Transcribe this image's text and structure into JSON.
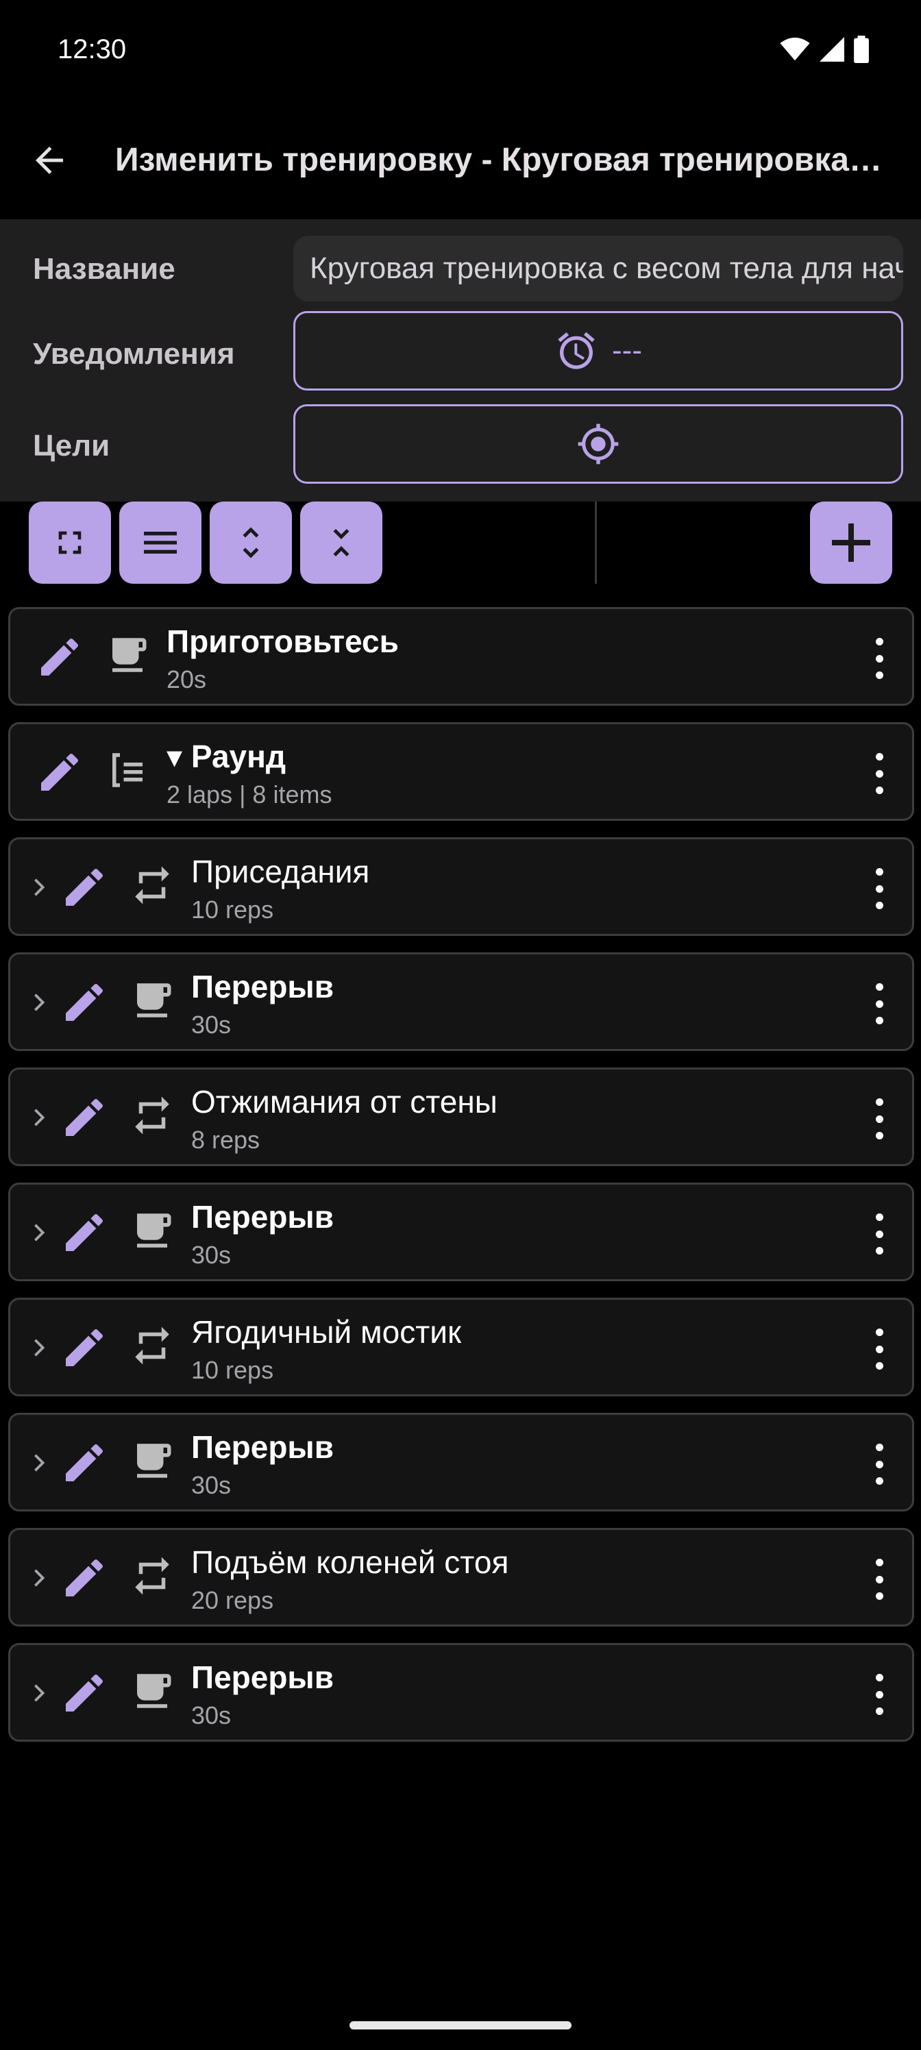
{
  "status_bar": {
    "time": "12:30"
  },
  "app_bar": {
    "title": "Изменить тренировку - Круговая тренировка с весом тела для начинающих"
  },
  "form": {
    "name_label": "Название",
    "name_value": "Круговая тренировка с весом тела для начинающих",
    "notifications_label": "Уведомления",
    "notifications_value": "---",
    "goals_label": "Цели"
  },
  "toolbar": {
    "buttons": [
      "expand-all",
      "list-view",
      "expand-vertical",
      "collapse-vertical",
      "add"
    ]
  },
  "items": [
    {
      "title": "Приготовьтесь",
      "subtitle": "20s",
      "type": "rest",
      "bold": true,
      "nested": false
    },
    {
      "title": "▾ Раунд",
      "subtitle": "2 laps | 8 items",
      "type": "group",
      "bold": true,
      "nested": false
    },
    {
      "title": "Приседания",
      "subtitle": "10 reps",
      "type": "reps",
      "bold": false,
      "nested": true
    },
    {
      "title": "Перерыв",
      "subtitle": "30s",
      "type": "rest",
      "bold": true,
      "nested": true
    },
    {
      "title": "Отжимания от стены",
      "subtitle": "8 reps",
      "type": "reps",
      "bold": false,
      "nested": true
    },
    {
      "title": "Перерыв",
      "subtitle": "30s",
      "type": "rest",
      "bold": true,
      "nested": true
    },
    {
      "title": "Ягодичный мостик",
      "subtitle": "10 reps",
      "type": "reps",
      "bold": false,
      "nested": true
    },
    {
      "title": "Перерыв",
      "subtitle": "30s",
      "type": "rest",
      "bold": true,
      "nested": true
    },
    {
      "title": "Подъём коленей стоя",
      "subtitle": "20 reps",
      "type": "reps",
      "bold": false,
      "nested": true
    },
    {
      "title": "Перерыв",
      "subtitle": "30s",
      "type": "rest",
      "bold": true,
      "nested": true
    }
  ],
  "colors": {
    "accent": "#b8a3e8",
    "card_bg": "#141414",
    "panel_bg": "#1f1f1f"
  }
}
